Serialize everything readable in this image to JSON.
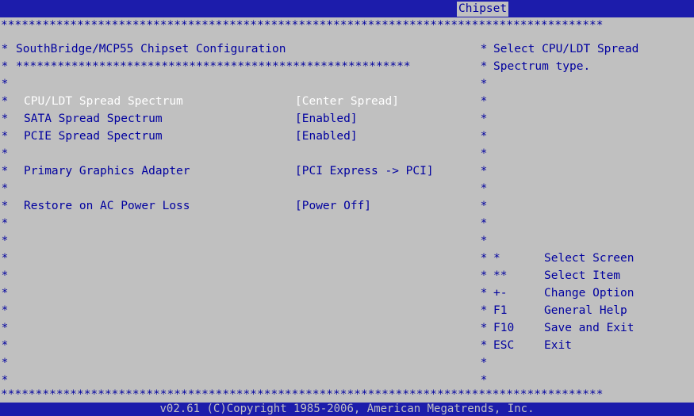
{
  "header": {
    "active_tab": "Chipset"
  },
  "border": {
    "stars_row": "***************************************************************************************",
    "divider_row": "*********************************************************"
  },
  "panel": {
    "title": "SouthBridge/MCP55 Chipset Configuration",
    "items": [
      {
        "label": "CPU/LDT Spread Spectrum",
        "value": "[Center Spread]",
        "selected": true
      },
      {
        "label": "SATA Spread Spectrum",
        "value": "[Enabled]",
        "selected": false
      },
      {
        "label": "PCIE Spread Spectrum",
        "value": "[Enabled]",
        "selected": false
      },
      {
        "label": "Primary Graphics Adapter",
        "value": "[PCI Express -> PCI]",
        "selected": false
      },
      {
        "label": "Restore on AC Power Loss",
        "value": "[Power Off]",
        "selected": false
      }
    ]
  },
  "help": {
    "line1": "Select CPU/LDT Spread",
    "line2": "Spectrum type."
  },
  "keys": [
    {
      "key": "*",
      "desc": "Select Screen"
    },
    {
      "key": "**",
      "desc": "Select Item"
    },
    {
      "key": "+-",
      "desc": "Change Option"
    },
    {
      "key": "F1",
      "desc": "General Help"
    },
    {
      "key": "F10",
      "desc": "Save and Exit"
    },
    {
      "key": "ESC",
      "desc": "Exit"
    }
  ],
  "footer": {
    "copyright": "v02.61 (C)Copyright 1985-2006, American Megatrends, Inc."
  }
}
